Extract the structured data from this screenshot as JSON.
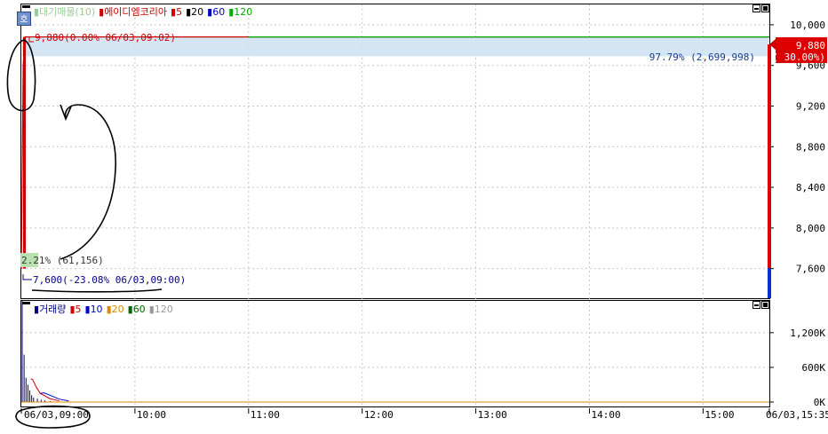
{
  "header": {
    "hoga_label": "호",
    "price_legend": [
      {
        "label": "대기매물(10)",
        "color": "#9acd9a"
      },
      {
        "label": "에이디엠코리아",
        "color": "#cc0000"
      },
      {
        "label": "5",
        "color": "#cc0000"
      },
      {
        "label": "20",
        "color": "#000000"
      },
      {
        "label": "60",
        "color": "#0000cc"
      },
      {
        "label": "120",
        "color": "#00aa00"
      }
    ],
    "volume_legend": [
      {
        "label": "거래량",
        "color": "#000080"
      },
      {
        "label": "5",
        "color": "#cc0000"
      },
      {
        "label": "10",
        "color": "#0000cc"
      },
      {
        "label": "20",
        "color": "#dd8800"
      },
      {
        "label": "60",
        "color": "#006600"
      },
      {
        "label": "120",
        "color": "#999999"
      }
    ]
  },
  "annotations": {
    "high_marker": "9,880(0.00% 06/03,09:02)",
    "low_marker": "7,600(-23.08% 06/03,09:00)",
    "band_top": "97.79% (2,699,998)",
    "band_bottom": "2.21% (61,156)",
    "current_price": "9,880",
    "current_change": "( 30.00%)"
  },
  "chart_data": [
    {
      "type": "line",
      "title": "에이디엠코리아",
      "ylim": [
        7300,
        10200
      ],
      "yticks": [
        {
          "value": 10000,
          "label": "10,000"
        },
        {
          "value": 9600,
          "label": "9,600"
        },
        {
          "value": 9200,
          "label": "9,200"
        },
        {
          "value": 8800,
          "label": "8,800"
        },
        {
          "value": 8400,
          "label": "8,400"
        },
        {
          "value": 8000,
          "label": "8,000"
        },
        {
          "value": 7600,
          "label": "7,600"
        }
      ],
      "x_range": [
        "09:00",
        "15:35"
      ],
      "x_ticks": [
        "06/03,09:00",
        "10:00",
        "11:00",
        "12:00",
        "13:00",
        "14:00",
        "15:00",
        "06/03,15:35"
      ],
      "series": [
        {
          "name": "에이디엠코리아",
          "color": "#cc0000",
          "x": [
            "09:00",
            "09:01",
            "09:02",
            "09:05",
            "09:10",
            "10:00",
            "11:00",
            "15:35"
          ],
          "values": [
            7600,
            9600,
            9880,
            9880,
            9880,
            9880,
            9880,
            9880
          ]
        },
        {
          "name": "120",
          "color": "#00aa00",
          "x": [
            "11:00",
            "15:35"
          ],
          "values": [
            9880,
            9880
          ]
        }
      ],
      "volume_band": {
        "from": 9880,
        "to": 9690,
        "top_share": 97.79,
        "top_volume": 2699998,
        "bottom_share": 2.21,
        "bottom_volume": 61156
      }
    },
    {
      "type": "bar",
      "title": "거래량",
      "ylim": [
        0,
        1750000
      ],
      "yticks": [
        {
          "value": 1200000,
          "label": "1,200K"
        },
        {
          "value": 600000,
          "label": "600K"
        },
        {
          "value": 0,
          "label": "0K"
        }
      ],
      "bars_x": [
        "09:00",
        "09:01",
        "09:02",
        "09:03",
        "09:04",
        "09:05",
        "09:06",
        "09:08",
        "09:10",
        "09:12",
        "09:15"
      ],
      "bars_values": [
        1750000,
        820000,
        420000,
        300000,
        200000,
        120000,
        80000,
        60000,
        40000,
        30000,
        20000
      ],
      "ma_series": [
        {
          "name": "5",
          "color": "#cc0000",
          "x": [
            "09:05",
            "09:06",
            "09:08",
            "09:10",
            "09:15",
            "09:20"
          ],
          "values": [
            400000,
            390000,
            250000,
            150000,
            60000,
            20000
          ]
        },
        {
          "name": "10",
          "color": "#0000cc",
          "x": [
            "09:10",
            "09:12",
            "09:15",
            "09:20",
            "09:25"
          ],
          "values": [
            150000,
            160000,
            120000,
            50000,
            20000
          ]
        }
      ]
    }
  ]
}
